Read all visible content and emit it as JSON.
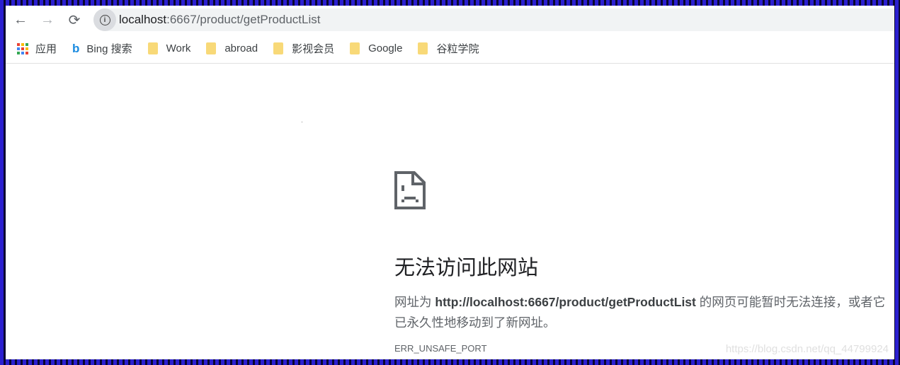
{
  "browser": {
    "url_host": "localhost",
    "url_path": ":6667/product/getProductList",
    "bookmarks": [
      {
        "label": "应用",
        "icon": "apps-icon"
      },
      {
        "label": "Bing 搜索",
        "icon": "bing-icon"
      },
      {
        "label": "Work",
        "icon": "folder-icon"
      },
      {
        "label": "abroad",
        "icon": "folder-icon"
      },
      {
        "label": "影视会员",
        "icon": "folder-icon"
      },
      {
        "label": "Google",
        "icon": "folder-icon"
      },
      {
        "label": "谷粒学院",
        "icon": "folder-icon"
      }
    ]
  },
  "error": {
    "icon": "sad-page-icon",
    "title": "无法访问此网站",
    "desc_prefix": "网址为 ",
    "desc_url": "http://localhost:6667/product/getProductList",
    "desc_suffix": " 的网页可能暂时无法连接，或者它已永久性地移动到了新网址。",
    "code": "ERR_UNSAFE_PORT"
  },
  "watermark": "https://blog.csdn.net/qq_44799924"
}
